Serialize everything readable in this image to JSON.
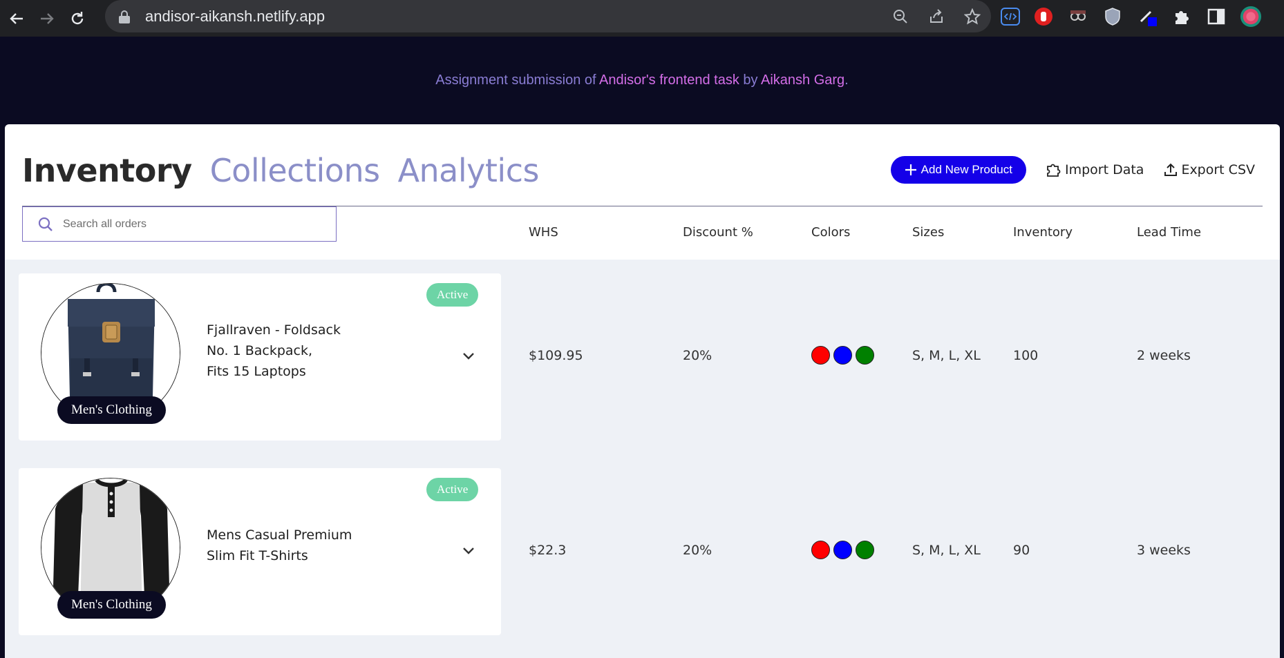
{
  "browser": {
    "url": "andisor-aikansh.netlify.app"
  },
  "banner": {
    "prefix": "Assignment submission of ",
    "task_link": "Andisor's frontend task",
    "by": " by ",
    "author_link": "Aikansh Garg",
    "suffix": "."
  },
  "tabs": [
    {
      "label": "Inventory",
      "active": true
    },
    {
      "label": "Collections",
      "active": false
    },
    {
      "label": "Analytics",
      "active": false
    }
  ],
  "actions": {
    "add_label": "Add New Product",
    "import_label": "Import Data",
    "export_label": "Export CSV"
  },
  "search": {
    "placeholder": "Search all orders",
    "value": ""
  },
  "columns": [
    "WHS",
    "Discount %",
    "Colors",
    "Sizes",
    "Inventory",
    "Lead Time"
  ],
  "products": [
    {
      "title_lines": [
        "Fjallraven - Foldsack",
        "No. 1 Backpack,",
        "Fits 15 Laptops"
      ],
      "category": "Men's Clothing",
      "status": "Active",
      "whs": "$109.95",
      "discount": "20%",
      "colors": [
        "#ff0000",
        "#0000ff",
        "#008000"
      ],
      "sizes": "S, M, L, XL",
      "inventory": "100",
      "lead_time": "2 weeks"
    },
    {
      "title_lines": [
        "Mens Casual Premium",
        "Slim Fit T-Shirts"
      ],
      "category": "Men's Clothing",
      "status": "Active",
      "whs": "$22.3",
      "discount": "20%",
      "colors": [
        "#ff0000",
        "#0000ff",
        "#008000"
      ],
      "sizes": "S, M, L, XL",
      "inventory": "90",
      "lead_time": "3 weeks"
    }
  ],
  "icons": {
    "back": "arrow-left-icon",
    "forward": "arrow-right-icon",
    "reload": "reload-icon",
    "lock": "lock-icon",
    "zoom": "zoom-icon",
    "share": "share-icon",
    "bookmark": "star-icon",
    "search": "search-icon",
    "chevron": "chevron-down-icon",
    "puzzle": "puzzle-icon",
    "upload": "upload-icon"
  },
  "colors": {
    "accent": "#1400e8",
    "active_badge": "#6dd4a6",
    "tab_inactive": "#8b8fc8",
    "banner_bg": "#0b0b22"
  }
}
